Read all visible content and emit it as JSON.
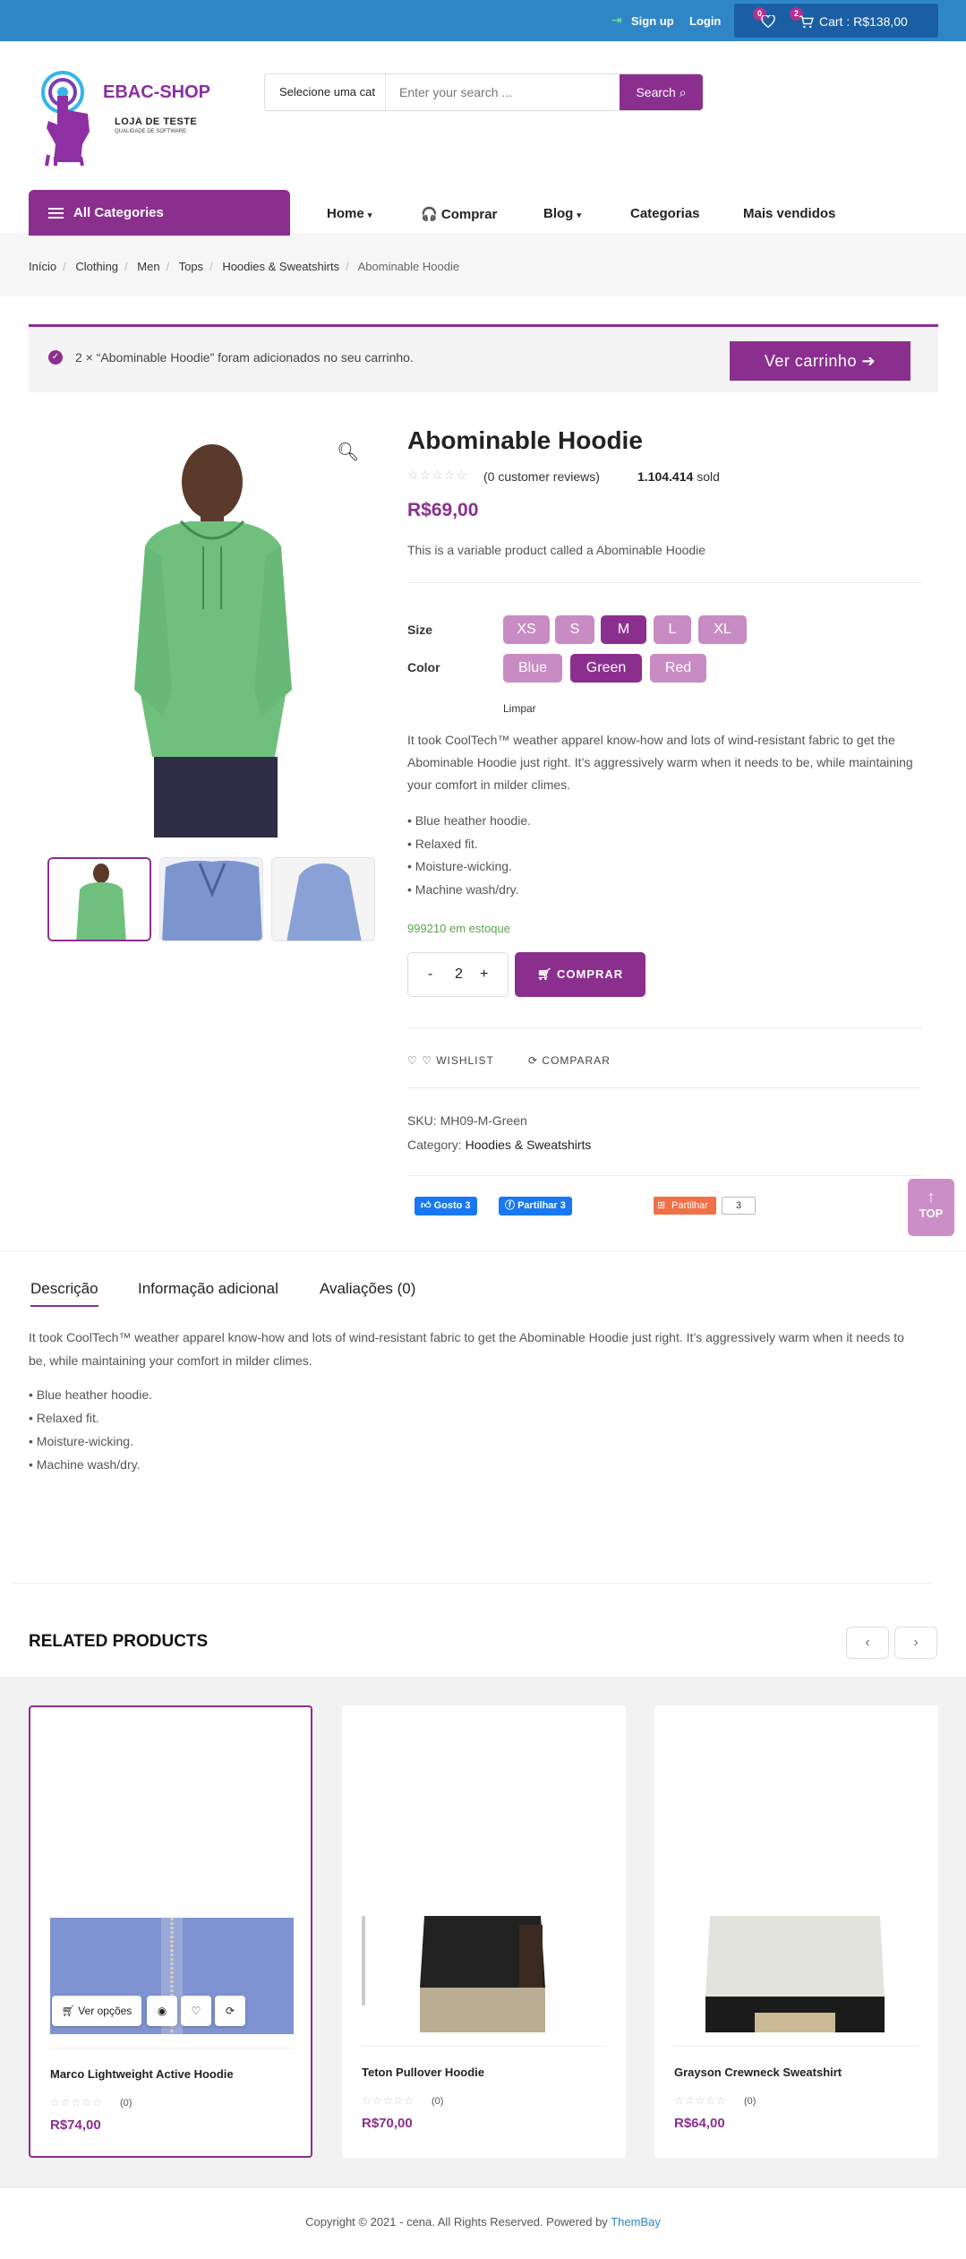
{
  "topbar": {
    "signup": "Sign up",
    "login": "Login",
    "wishlist_count": "0",
    "cart_count": "2",
    "cart_label": "Cart : R$138,00"
  },
  "logo": {
    "title": "EBAC-SHOP",
    "subtitle": "LOJA DE TESTE",
    "tagline": "QUALIDADE DE SOFTWARE"
  },
  "search": {
    "category": "Selecione uma cat",
    "placeholder": "Enter your search ...",
    "button": "Search"
  },
  "nav": {
    "all_categories": "All Categories",
    "items": [
      "Home",
      "Comprar",
      "Blog",
      "Categorias",
      "Mais vendidos"
    ]
  },
  "breadcrumb": [
    "Início",
    "Clothing",
    "Men",
    "Tops",
    "Hoodies & Sweatshirts",
    "Abominable Hoodie"
  ],
  "notice": {
    "text": "2 × “Abominable Hoodie” foram adicionados no seu carrinho.",
    "button": "Ver carrinho"
  },
  "product": {
    "title": "Abominable Hoodie",
    "reviews": "(0 customer reviews)",
    "sold_count": "1.104.414",
    "sold_label": "sold",
    "price": "R$69,00",
    "short_desc": "This is a variable product called a Abominable Hoodie",
    "size_label": "Size",
    "sizes": [
      "XS",
      "S",
      "M",
      "L",
      "XL"
    ],
    "selected_size": "M",
    "color_label": "Color",
    "colors": [
      "Blue",
      "Green",
      "Red"
    ],
    "selected_color": "Green",
    "clear": "Limpar",
    "description": "It took CoolTech™ weather apparel know-how and lots of wind-resistant fabric to get the Abominable Hoodie just right. It’s aggressively warm when it needs to be, while maintaining your comfort in milder climes.",
    "bullets": [
      "• Blue heather hoodie.",
      "• Relaxed fit.",
      "• Moisture-wicking.",
      "• Machine wash/dry."
    ],
    "stock": "999210 em estoque",
    "qty_minus": "-",
    "qty": "2",
    "qty_plus": "+",
    "buy": "COMPRAR",
    "wishlist": "WISHLIST",
    "compare": "COMPARAR",
    "sku_label": "SKU:",
    "sku": "MH09-M-Green",
    "category_label": "Category:",
    "category": "Hoodies & Sweatshirts"
  },
  "social": {
    "like": "Gosto 3",
    "share_fb": "Partilhar 3",
    "share": "Partilhar",
    "share_count": "3"
  },
  "totop": "TOP",
  "tabs": [
    "Descrição",
    "Informação adicional",
    "Avaliações (0)"
  ],
  "tab_desc": {
    "text": "It took CoolTech™ weather apparel know-how and lots of wind-resistant fabric to get the Abominable Hoodie just right. It’s aggressively warm when it needs to be, while maintaining your comfort in milder climes.",
    "bullets": [
      "• Blue heather hoodie.",
      "• Relaxed fit.",
      "• Moisture-wicking.",
      "• Machine wash/dry."
    ]
  },
  "related": {
    "heading": "RELATED PRODUCTS",
    "view_options": "Ver opções",
    "items": [
      {
        "name": "Marco Lightweight Active Hoodie",
        "count": "(0)",
        "price": "R$74,00"
      },
      {
        "name": "Teton Pullover Hoodie",
        "count": "(0)",
        "price": "R$70,00"
      },
      {
        "name": "Grayson Crewneck Sweatshirt",
        "count": "(0)",
        "price": "R$64,00"
      }
    ]
  },
  "footer": {
    "copyright": "Copyright © 2021 - cena. All Rights Reserved. Powered by",
    "powered_by": "ThemBay"
  },
  "colors": {
    "primary": "#8b2f8e",
    "topbar": "#2e86c7",
    "swatch": "#c98bc3",
    "stock": "#58a34e"
  }
}
